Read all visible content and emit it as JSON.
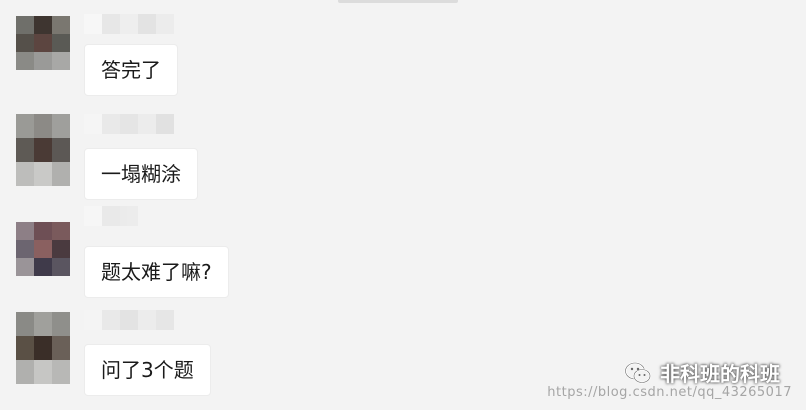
{
  "messages": [
    {
      "text": "答完了"
    },
    {
      "text": "一塌糊涂"
    },
    {
      "text": "题太难了嘛?"
    },
    {
      "text": "问了3个题"
    }
  ],
  "watermark": {
    "url": "https://blog.csdn.net/qq_43265017",
    "brand": "非科班的科班"
  },
  "colors": {
    "background": "#f3f3f3",
    "bubble": "#ffffff",
    "text": "#1a1a1a"
  },
  "icons": {
    "brand": "wechat-icon"
  }
}
